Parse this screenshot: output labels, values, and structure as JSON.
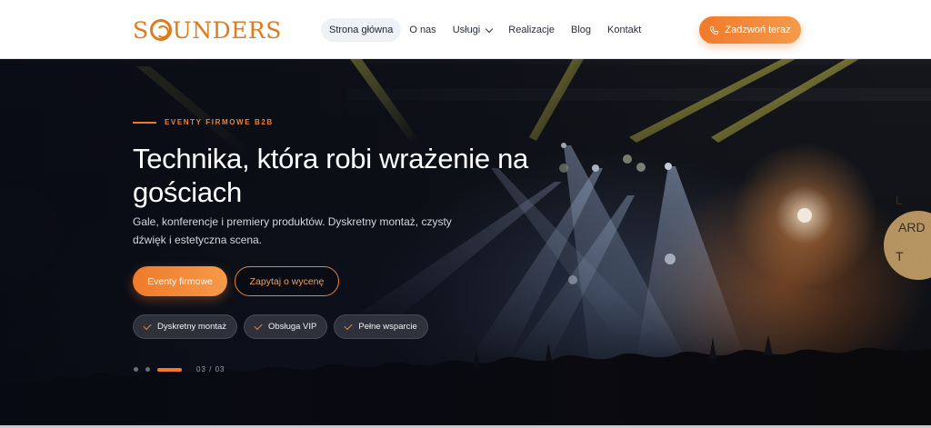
{
  "brand": {
    "logo_text_pre": "S",
    "logo_text_post": "UNDERS",
    "accent": "#f07a2a"
  },
  "nav": {
    "items": [
      {
        "label": "Strona główna",
        "active": true
      },
      {
        "label": "O nas"
      },
      {
        "label": "Usługi",
        "has_dropdown": true
      },
      {
        "label": "Realizacje"
      },
      {
        "label": "Blog"
      },
      {
        "label": "Kontakt"
      }
    ],
    "cta_label": "Zadzwoń teraz",
    "cta_icon": "phone-icon"
  },
  "hero": {
    "eyebrow": "EVENTY FIRMOWE B2B",
    "title": "Technika, która robi wrażenie na gościach",
    "subtitle": "Gale, konferencje i premiery produktów. Dyskretny montaż, czysty dźwięk i estetyczna scena.",
    "primary_button": "Eventy firmowe",
    "secondary_button": "Zapytaj o wycenę",
    "badges": [
      "Dyskretny montaż",
      "Obsługa VIP",
      "Pełne wsparcie"
    ],
    "slide_counter": "03 / 03",
    "current_slide": 3,
    "total_slides": 3
  }
}
